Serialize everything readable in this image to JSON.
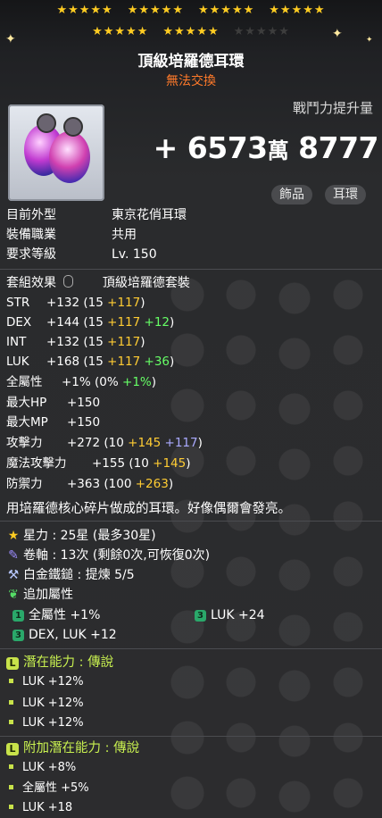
{
  "stars": {
    "row1": 20,
    "row2_filled": 10,
    "row2_total": 15
  },
  "item": {
    "name": "頂級培羅德耳環",
    "trade": "無法交換"
  },
  "combat_power": {
    "label": "戰鬥力提升量",
    "sign": "+",
    "main": "6573",
    "unit": "萬",
    "rest": "8777"
  },
  "tags": [
    "飾品",
    "耳環"
  ],
  "info": [
    {
      "k": "目前外型",
      "v": "東京花俏耳環"
    },
    {
      "k": "裝備職業",
      "v": "共用"
    },
    {
      "k": "要求等級",
      "v": "Lv. 150"
    }
  ],
  "set": {
    "label": "套組效果",
    "name": "頂級培羅德套裝"
  },
  "stats": [
    {
      "name": "STR",
      "total": "+132",
      "base": "(15",
      "plus1": "+117",
      "plus2": "",
      "close": ")"
    },
    {
      "name": "DEX",
      "total": "+144",
      "base": "(15",
      "plus1": "+117",
      "plus2": "+12",
      "close": ")"
    },
    {
      "name": "INT",
      "total": "+132",
      "base": "(15",
      "plus1": "+117",
      "plus2": "",
      "close": ")"
    },
    {
      "name": "LUK",
      "total": "+168",
      "base": "(15",
      "plus1": "+117",
      "plus2": "+36",
      "close": ")"
    }
  ],
  "allstat": {
    "name": "全屬性",
    "total": "+1%",
    "base": "(0%",
    "plus": "+1%",
    "close": ")"
  },
  "simple_stats": [
    {
      "name": "最大HP",
      "val": "+150"
    },
    {
      "name": "最大MP",
      "val": "+150"
    }
  ],
  "attack_stats": [
    {
      "name": "攻擊力",
      "total": "+272",
      "base": "(10",
      "plus1": "+145",
      "plus2": "+117",
      "close": ")"
    },
    {
      "name": "魔法攻擊力",
      "total": "+155",
      "base": "(10",
      "plus1": "+145",
      "plus2": "",
      "close": ")"
    },
    {
      "name": "防禦力",
      "total": "+363",
      "base": "(100",
      "plus1": "+263",
      "plus2": "",
      "close": ")"
    }
  ],
  "description": "用培羅德核心碎片做成的耳環。好像偶爾會發亮。",
  "star_force": "星力 : 25星 (最多30星)",
  "scroll": "卷軸 : 13次 (剩餘0次,可恢復0次)",
  "hammer": "白金鐵鎚 : 提煉 5/5",
  "bonus": {
    "label": "追加屬性",
    "items": [
      {
        "tier": "1",
        "text": "全屬性 +1%"
      },
      {
        "tier": "3",
        "text": "LUK +24"
      },
      {
        "tier": "3",
        "text": "DEX, LUK +12"
      }
    ]
  },
  "potential": {
    "label": "潛在能力 : 傳說",
    "lines": [
      "LUK +12%",
      "LUK +12%",
      "LUK +12%"
    ]
  },
  "additional": {
    "label": "附加潛在能力 : 傳說",
    "lines": [
      "LUK +8%",
      "全屬性 +5%",
      "LUK +18"
    ]
  },
  "colors": {
    "accent_yellow": "#ffcc33",
    "accent_green": "#66ff66",
    "trade_orange": "#ff7a2a",
    "legend_green": "#c8f050"
  }
}
